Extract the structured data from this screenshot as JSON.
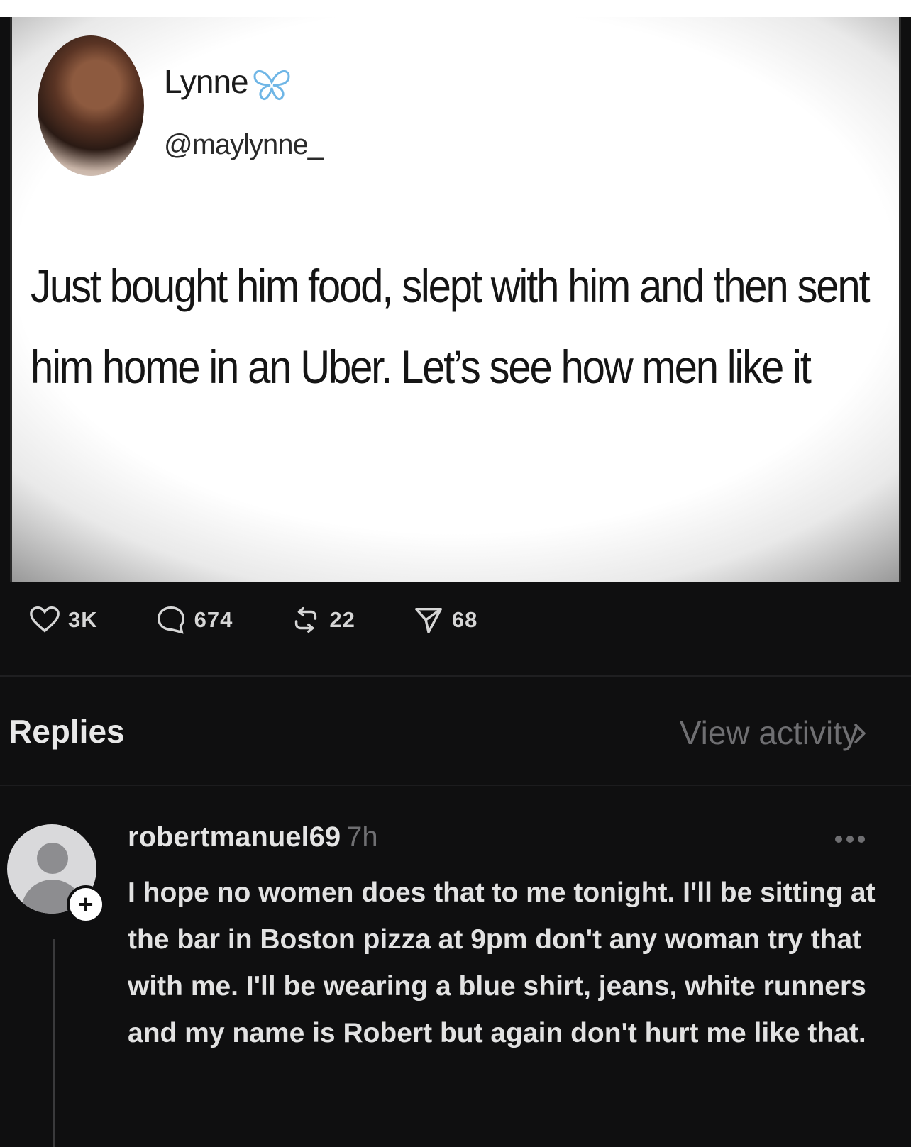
{
  "tweet": {
    "display_name": "Lynne",
    "handle": "@maylynne_",
    "text": "Just bought him food, slept with him and then sent him home in an Uber. Let’s see how men like it",
    "icons": [
      "butterfly-icon"
    ]
  },
  "stats": {
    "likes": "3K",
    "comments": "674",
    "reposts": "22",
    "shares": "68"
  },
  "section": {
    "replies_label": "Replies",
    "view_activity_label": "View activity"
  },
  "reply": {
    "username": "robertmanuel69",
    "time": "7h",
    "text": "I hope no women does that to me tonight. I'll be sitting at the bar in Boston pizza at 9pm don't any woman try that with me. I'll be wearing a blue shirt, jeans, white runners and my name is Robert but again don't hurt me like that.",
    "follow_badge": "+"
  },
  "colors": {
    "background": "#0f0f10",
    "butterfly": "#6fb6e6",
    "muted": "#6f6f72"
  }
}
